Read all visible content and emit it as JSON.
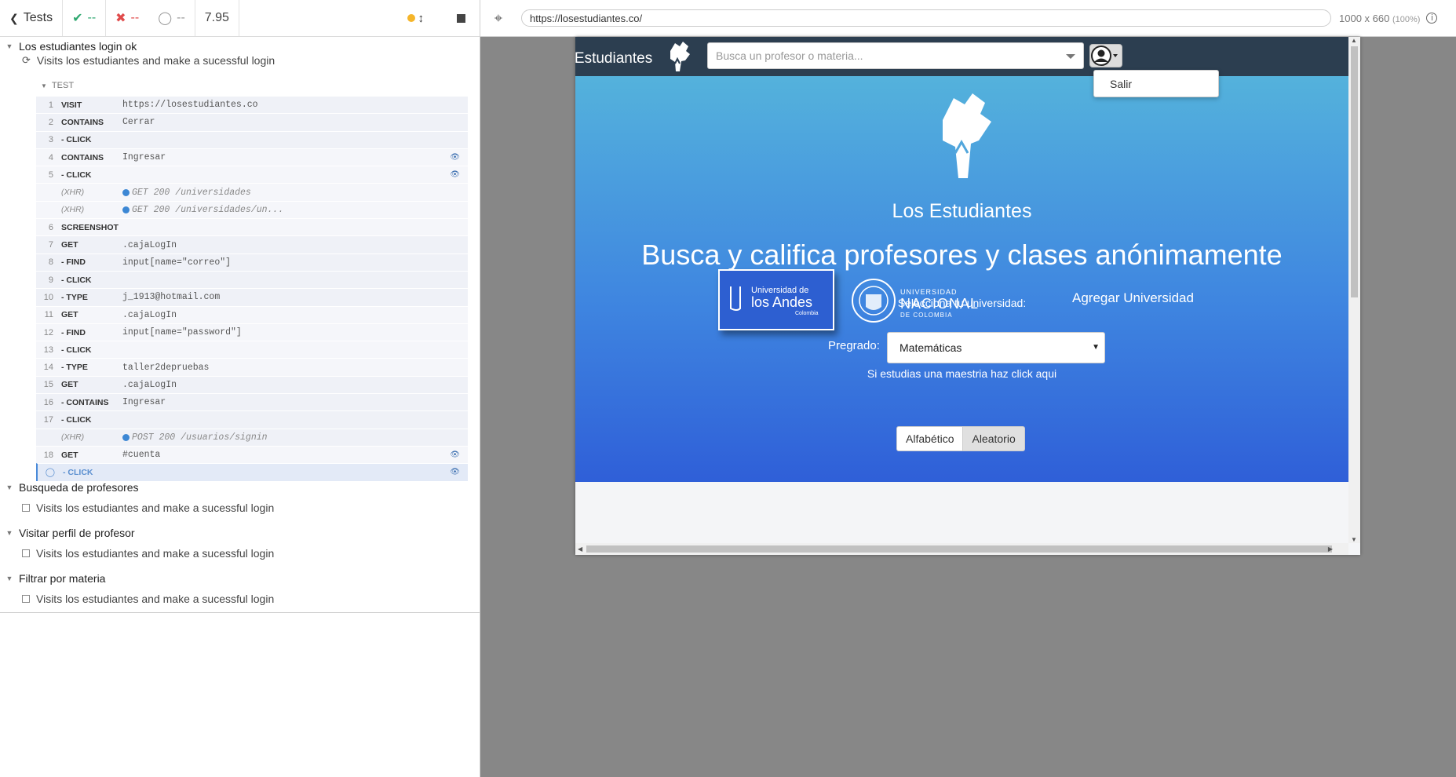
{
  "reporter": {
    "tests_label": "Tests",
    "passed": "--",
    "failed": "--",
    "pending": "--",
    "duration": "7.95",
    "suites": [
      {
        "title": "Los estudiantes login ok",
        "test": "Visits los estudiantes and make a sucessful login",
        "section_label": "TEST",
        "commands": [
          {
            "num": "1",
            "name": "VISIT",
            "msg": "https://losestudiantes.co"
          },
          {
            "num": "2",
            "name": "CONTAINS",
            "msg": "Cerrar"
          },
          {
            "num": "3",
            "name": "- CLICK",
            "msg": ""
          },
          {
            "num": "4",
            "name": "CONTAINS",
            "msg": "Ingresar"
          },
          {
            "num": "5",
            "name": "- CLICK",
            "msg": ""
          },
          {
            "num": "",
            "name": "(XHR)",
            "msg": "GET 200 /universidades"
          },
          {
            "num": "",
            "name": "(XHR)",
            "msg": "GET 200 /universidades/un..."
          },
          {
            "num": "6",
            "name": "SCREENSHOT",
            "msg": ""
          },
          {
            "num": "7",
            "name": "GET",
            "msg": ".cajaLogIn"
          },
          {
            "num": "8",
            "name": "- FIND",
            "msg": "input[name=\"correo\"]"
          },
          {
            "num": "9",
            "name": "- CLICK",
            "msg": ""
          },
          {
            "num": "10",
            "name": "- TYPE",
            "msg": "j_1913@hotmail.com"
          },
          {
            "num": "11",
            "name": "GET",
            "msg": ".cajaLogIn"
          },
          {
            "num": "12",
            "name": "- FIND",
            "msg": "input[name=\"password\"]"
          },
          {
            "num": "13",
            "name": "- CLICK",
            "msg": ""
          },
          {
            "num": "14",
            "name": "- TYPE",
            "msg": "taller2depruebas"
          },
          {
            "num": "15",
            "name": "GET",
            "msg": ".cajaLogIn"
          },
          {
            "num": "16",
            "name": "- CONTAINS",
            "msg": "Ingresar"
          },
          {
            "num": "17",
            "name": "- CLICK",
            "msg": ""
          },
          {
            "num": "",
            "name": "(XHR)",
            "msg": "POST 200 /usuarios/signin"
          },
          {
            "num": "18",
            "name": "GET",
            "msg": "#cuenta"
          },
          {
            "num": "",
            "name": "- CLICK",
            "msg": ""
          }
        ]
      },
      {
        "title": "Busqueda de profesores",
        "test": "Visits los estudiantes and make a sucessful login"
      },
      {
        "title": "Visitar perfil de profesor",
        "test": "Visits los estudiantes and make a sucessful login"
      },
      {
        "title": "Filtrar por materia",
        "test": "Visits los estudiantes and make a sucessful login"
      }
    ]
  },
  "runner": {
    "url": "https://losestudiantes.co/",
    "viewport": "1000 x 660",
    "zoom": "(100%)"
  },
  "app": {
    "brand": "Los Estudiantes",
    "search_placeholder": "Busca un profesor o materia...",
    "user_menu_item": "Salir",
    "hero_name": "Los Estudiantes",
    "tagline": "Busca y califica profesores y clases anónimamente",
    "select_university": "Selecciona tu universidad:",
    "andes_line1": "Universidad de",
    "andes_line2": "los Andes",
    "andes_line3": "Colombia",
    "nacional_line1": "UNIVERSIDAD",
    "nacional_line2": "NACIONAL",
    "nacional_line3": "DE COLOMBIA",
    "add_university": "Agregar Universidad",
    "pregrado_label": "Pregrado:",
    "pregrado_value": "Matemáticas",
    "maestria_link": "Si estudias una maestria haz click aqui",
    "sort_alpha": "Alfabético",
    "sort_random": "Aleatorio"
  },
  "colors": {
    "nav_bg": "#2c3e50",
    "hero_top": "#54b2dc",
    "hero_bottom": "#2f5fd8",
    "pass": "#2fa870",
    "fail": "#e04b4b",
    "xhr_dot": "#3c87d4"
  }
}
